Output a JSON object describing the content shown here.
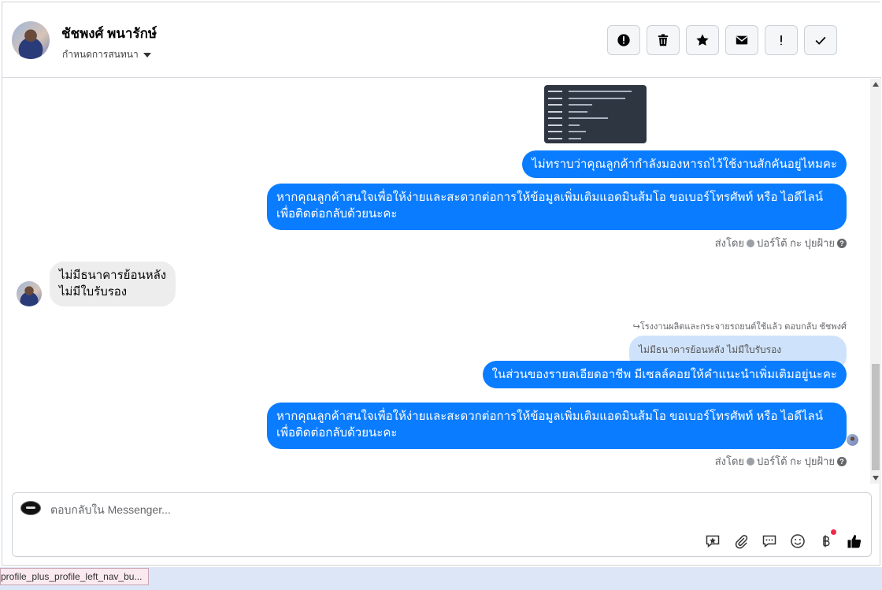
{
  "header": {
    "name": "ชัชพงศ์ พนารักษ์",
    "subtitle": "กำหนดการสนทนา",
    "buttons": [
      {
        "name": "alert-circle-icon"
      },
      {
        "name": "trash-icon"
      },
      {
        "name": "star-icon"
      },
      {
        "name": "envelope-icon"
      },
      {
        "name": "exclamation-icon"
      },
      {
        "name": "check-icon"
      }
    ]
  },
  "conversation": {
    "messages": [
      {
        "text": "ไม่ทราบว่าคุณลูกค้ากำลังมองหารถไว้ใช้งานสักคันอยู่ไหมคะ"
      },
      {
        "text": "หากคุณลูกค้าสนใจเพื่อให้ง่ายและสะดวกต่อการให้ข้อมูลเพิ่มเติมแอดมินส้มโอ ขอเบอร์โทรศัพท์ หรือ ไอดีไลน์ เพื่อติดต่อกลับด้วยนะคะ"
      },
      {
        "text": "ไม่มีธนาคารย้อนหลัง\nไม่มีใบรับรอง"
      },
      {
        "text": "ในส่วนของรายลเอียดอาชีพ มีเซลล์คอยให้คำแนะนำเพิ่มเติมอยู่นะคะ"
      },
      {
        "text": "หากคุณลูกค้าสนใจเพื่อให้ง่ายและสะดวกต่อการให้ข้อมูลเพิ่มเติมแอดมินส้มโอ ขอเบอร์โทรศัพท์ หรือ ไอดีไลน์ เพื่อติดต่อกลับด้วยนะคะ"
      }
    ],
    "sent_by_prefix": "ส่งโดย",
    "sent_by_name": "ปอร์โต้ กะ ปุยฝ้าย",
    "replied_note": "โรงงานผลิตและกระจายรถยนต์ใช้แล้ว ตอบกลับ ชัชพงศ์",
    "quoted_text": "ไม่มีธนาคารย้อนหลัง ไม่มีใบรับรอง"
  },
  "composer": {
    "placeholder": "ตอบกลับใน Messenger...",
    "tools": [
      "saved-reply-icon",
      "attachment-icon",
      "chat-bubble-icon",
      "emoji-icon",
      "baht-icon",
      "like-icon"
    ]
  },
  "status_bar": {
    "url": "profile_plus_profile_left_nav_bu..."
  },
  "colors": {
    "outgoing_bubble": "#0a7cff",
    "incoming_bubble": "#ededed",
    "quote_bubble": "#cfe2fb",
    "notification_dot": "#f02849"
  }
}
